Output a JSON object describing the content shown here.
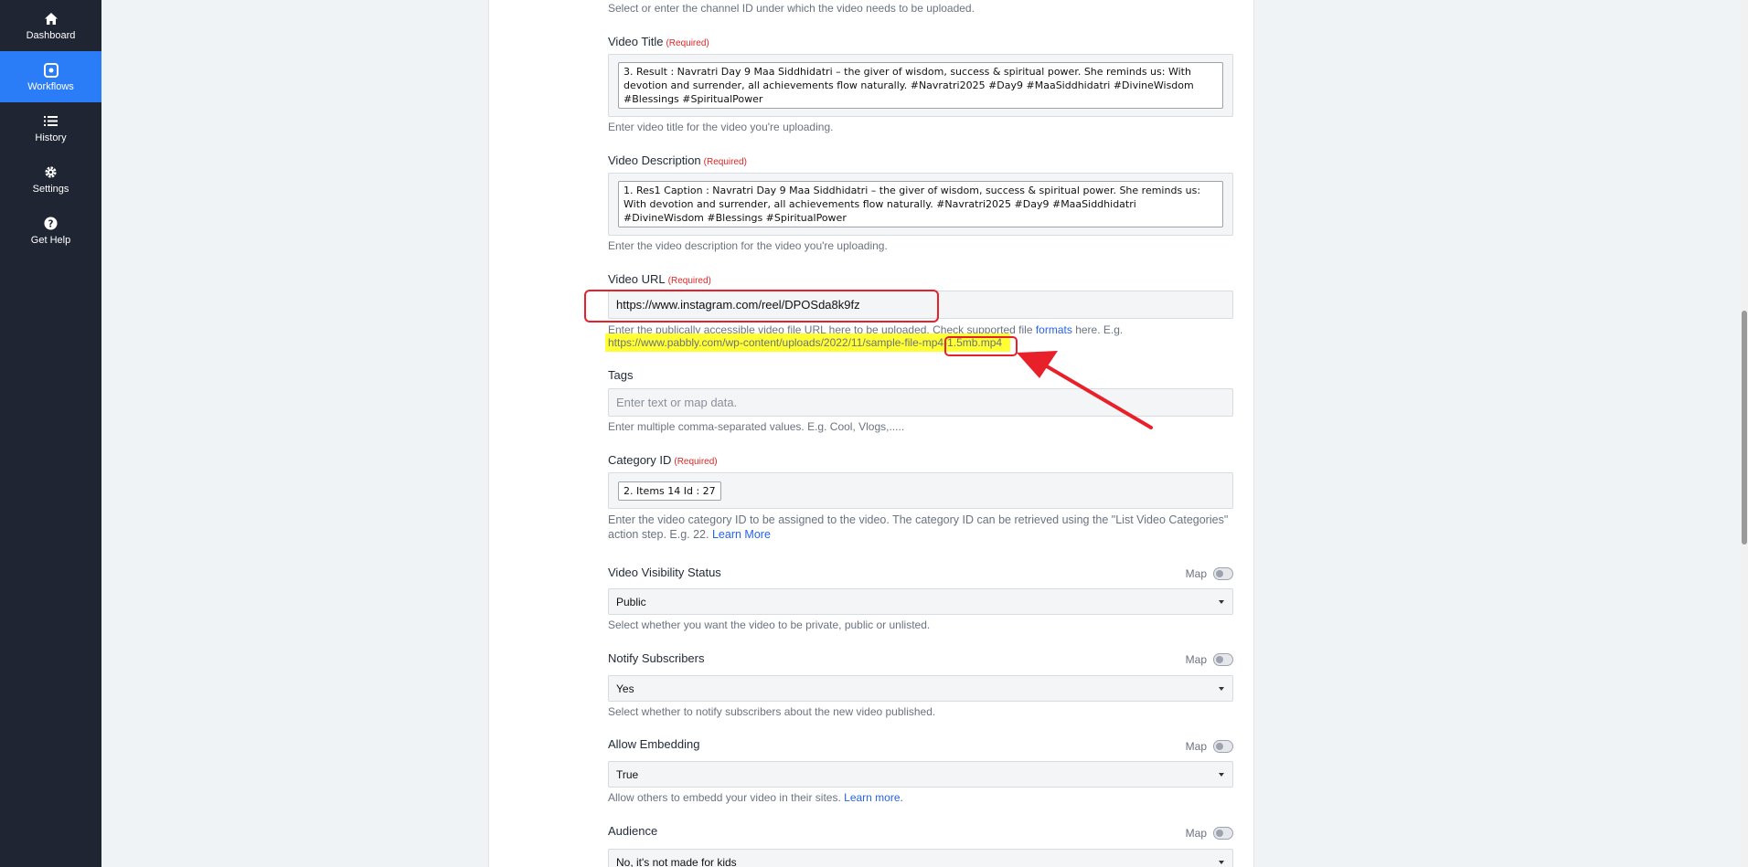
{
  "sidebar": {
    "items": [
      {
        "label": "Dashboard",
        "icon": "home-icon"
      },
      {
        "label": "Workflows",
        "icon": "workflow-icon",
        "active": true
      },
      {
        "label": "History",
        "icon": "list-icon"
      },
      {
        "label": "Settings",
        "icon": "gear-icon"
      },
      {
        "label": "Get Help",
        "icon": "question-icon"
      }
    ]
  },
  "form": {
    "channel_help": "Select or enter the channel ID under which the video needs to be uploaded.",
    "required_tag": "(Required)",
    "video_title": {
      "label": "Video Title",
      "value": "3. Result : Navratri Day 9 Maa Siddhidatri – the giver of wisdom, success & spiritual power. She reminds us: With devotion and surrender, all achievements flow naturally. #Navratri2025 #Day9 #MaaSiddhidatri #DivineWisdom #Blessings #SpiritualPower",
      "help": "Enter video title for the video you're uploading."
    },
    "video_description": {
      "label": "Video Description",
      "value": "1. Res1 Caption : Navratri Day 9 Maa Siddhidatri – the giver of wisdom, success & spiritual power. She reminds us: With devotion and surrender, all achievements flow naturally. #Navratri2025 #Day9 #MaaSiddhidatri #DivineWisdom #Blessings #SpiritualPower",
      "help": "Enter the video description for the video you're uploading."
    },
    "video_url": {
      "label": "Video URL",
      "value": "https://www.instagram.com/reel/DPOSda8k9fz",
      "help_prefix": "Enter the publically accessible video file URL here to be uploaded. Check supported file",
      "help_link": "formats",
      "help_suffix": "here. E.g.",
      "example_url": "https://www.pabbly.com/wp-content/uploads/2022/11/sample-file-mp4-1.5mb.mp4"
    },
    "tags": {
      "label": "Tags",
      "placeholder": "Enter text or map data.",
      "help": "Enter multiple comma-separated values. E.g. Cool, Vlogs,....."
    },
    "category_id": {
      "label": "Category ID",
      "value": "2. Items 14 Id : 27",
      "help": "Enter the video category ID to be assigned to the video. The category ID can be retrieved using the \"List Video Categories\" action step. E.g. 22.",
      "help_link": "Learn More"
    },
    "map_label": "Map",
    "visibility": {
      "label": "Video Visibility Status",
      "value": "Public",
      "help": "Select whether you want the video to be private, public or unlisted."
    },
    "notify": {
      "label": "Notify Subscribers",
      "value": "Yes",
      "help": "Select whether to notify subscribers about the new video published."
    },
    "embedding": {
      "label": "Allow Embedding",
      "value": "True",
      "help": "Allow others to embedd your video in their sites.",
      "help_link": "Learn more."
    },
    "audience": {
      "label": "Audience",
      "value": "No, it's not made for kids"
    }
  },
  "annotation_color": "#e8202a",
  "highlight_color": "#ffff33",
  "accent_color": "#2b7df7"
}
